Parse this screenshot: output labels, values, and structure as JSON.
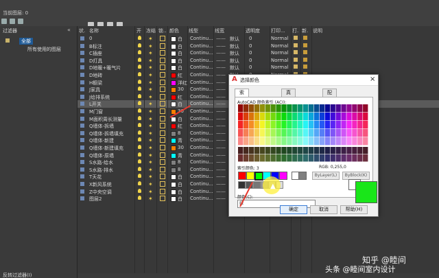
{
  "topbar": {
    "current_layer": "当前图层: 0"
  },
  "left_panel": {
    "title": "过滤器",
    "all": "全部",
    "used": "所有使用的图层",
    "reverse": "反转过滤器(I)",
    "collapse": "«"
  },
  "headers": [
    "状.",
    "名称",
    "开",
    "冻结",
    "锁..",
    "颜色",
    "线型",
    "线宽",
    "透明度",
    "打印...",
    "打.",
    "新.",
    "说明"
  ],
  "layers": [
    {
      "name": "0",
      "color_name": "白",
      "swatch": "#ffffff",
      "linetype": "Continu...",
      "lw": "默认",
      "tr": "0",
      "plot": "Normal"
    },
    {
      "name": "B标注",
      "color_name": "白",
      "swatch": "#ffffff",
      "linetype": "Continu...",
      "lw": "默认",
      "tr": "0",
      "plot": "Normal"
    },
    {
      "name": "C插座",
      "color_name": "白",
      "swatch": "#ffffff",
      "linetype": "Continu...",
      "lw": "默认",
      "tr": "0",
      "plot": "Normal"
    },
    {
      "name": "D灯具",
      "color_name": "白",
      "swatch": "#ffffff",
      "linetype": "Continu...",
      "lw": "默认",
      "tr": "0",
      "plot": "Normal"
    },
    {
      "name": "D地暖+暖气片",
      "color_name": "白",
      "swatch": "#ffffff",
      "linetype": "Continu...",
      "lw": "默认",
      "tr": "0",
      "plot": "Normal"
    },
    {
      "name": "D地砖",
      "color_name": "红",
      "swatch": "#ff0000",
      "linetype": "Continu...",
      "lw": "默认",
      "tr": "0",
      "plot": "Normal"
    },
    {
      "name": "H橱梁",
      "color_name": "洋红",
      "swatch": "#ff00ff",
      "linetype": "Continu...",
      "lw": "默认",
      "tr": "0",
      "plot": "Normal"
    },
    {
      "name": "J家具",
      "color_name": "30",
      "swatch": "#ff7f00",
      "linetype": "Continu...",
      "lw": "默认",
      "tr": "0",
      "plot": "Normal"
    },
    {
      "name": "J给排系统",
      "color_name": "红",
      "swatch": "#ff0000",
      "linetype": "Continu...",
      "lw": "默认",
      "tr": "0",
      "plot": "Normal"
    },
    {
      "name": "L开关",
      "color_name": "白",
      "swatch": "#ffffff",
      "linetype": "Continu...",
      "lw": "默认",
      "tr": "0",
      "plot": "Normal"
    },
    {
      "name": "M门窗",
      "color_name": "30",
      "swatch": "#ff7f00",
      "linetype": "Continu...",
      "lw": "默认",
      "tr": "0",
      "plot": "Normal"
    },
    {
      "name": "M面积周长测量",
      "color_name": "白",
      "swatch": "#ffffff",
      "linetype": "Continu...",
      "lw": "默认",
      "tr": "0",
      "plot": "Normal"
    },
    {
      "name": "Q墙体-拆墙",
      "color_name": "红",
      "swatch": "#ff0000",
      "linetype": "Continu...",
      "lw": "默认",
      "tr": "0",
      "plot": "Normal"
    },
    {
      "name": "Q墙体-拆墙填充",
      "color_name": "8",
      "swatch": "#808080",
      "linetype": "Continu...",
      "lw": "默认",
      "tr": "0",
      "plot": "Normal"
    },
    {
      "name": "Q墙体-新建",
      "color_name": "青",
      "swatch": "#00ffff",
      "linetype": "Continu...",
      "lw": "默认",
      "tr": "0",
      "plot": "Normal"
    },
    {
      "name": "Q墙体-新建填充",
      "color_name": "30",
      "swatch": "#ff7f00",
      "linetype": "Continu...",
      "lw": "默认",
      "tr": "0",
      "plot": "Normal"
    },
    {
      "name": "Q墙体-原墙",
      "color_name": "青",
      "swatch": "#00ffff",
      "linetype": "Continu...",
      "lw": "默认",
      "tr": "0",
      "plot": "Normal"
    },
    {
      "name": "S水路-给水",
      "color_name": "8",
      "swatch": "#808080",
      "linetype": "Continu...",
      "lw": "默认",
      "tr": "0",
      "plot": "Normal"
    },
    {
      "name": "S水路-排水",
      "color_name": "8",
      "swatch": "#808080",
      "linetype": "Continu...",
      "lw": "默认",
      "tr": "0",
      "plot": "Normal"
    },
    {
      "name": "T天花",
      "color_name": "白",
      "swatch": "#ffffff",
      "linetype": "Continu...",
      "lw": "默认",
      "tr": "0",
      "plot": "Normal"
    },
    {
      "name": "X新风系统",
      "color_name": "白",
      "swatch": "#ffffff",
      "linetype": "Continu...",
      "lw": "默认",
      "tr": "0",
      "plot": "Normal"
    },
    {
      "name": "Z中央空调",
      "color_name": "白",
      "swatch": "#ffffff",
      "linetype": "Continu...",
      "lw": "默认",
      "tr": "0",
      "plot": "Normal"
    },
    {
      "name": "图层2",
      "color_name": "白",
      "swatch": "#ffffff",
      "linetype": "Continu...",
      "lw": "默认",
      "tr": "0",
      "plot": "Normal"
    }
  ],
  "selected_row": 9,
  "dialog": {
    "title": "选择颜色",
    "tabs": [
      "索引颜色",
      "真彩色",
      "配色系统"
    ],
    "aci_label": "AutoCAD 颜色索引 (ACI):",
    "index_label": "索引颜色:  3",
    "rgb_label": "RGB:        0,255,0",
    "bylayer": "ByLayer(L)",
    "byblock": "ByBlock(K)",
    "color_label": "颜色(C):",
    "color_value": "绿",
    "ok": "确定",
    "cancel": "取消",
    "help": "帮助(H)",
    "selected_color": "#19e619"
  },
  "watermark": {
    "line1": "知乎 @睦间",
    "line2": "头条 @睦间室内设计"
  }
}
